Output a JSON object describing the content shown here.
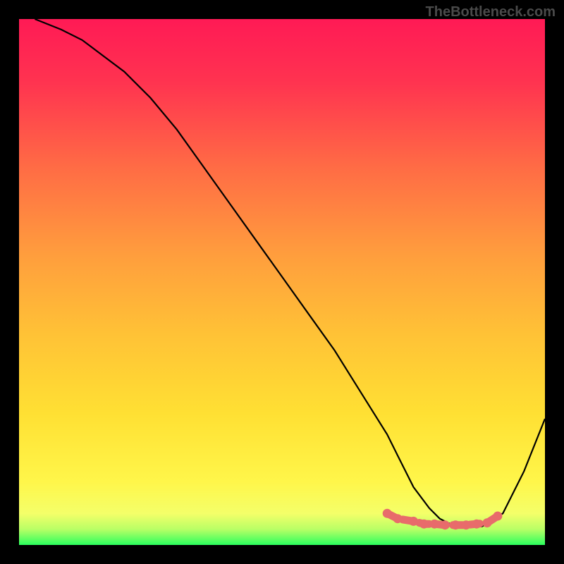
{
  "watermark": "TheBottleneck.com",
  "chart_data": {
    "type": "line",
    "title": "",
    "xlabel": "",
    "ylabel": "",
    "xlim": [
      0,
      100
    ],
    "ylim": [
      0,
      100
    ],
    "background_gradient": {
      "top_color": "#ff1a4d",
      "mid_color": "#ffd633",
      "bottom_green": "#2bff5e"
    },
    "series": [
      {
        "name": "main-curve",
        "color": "#000000",
        "x": [
          3,
          8,
          12,
          16,
          20,
          25,
          30,
          35,
          40,
          45,
          50,
          55,
          60,
          65,
          70,
          72,
          75,
          78,
          80,
          82,
          85,
          88,
          92,
          96,
          100
        ],
        "y": [
          100,
          98,
          96,
          93,
          90,
          85,
          79,
          72,
          65,
          58,
          51,
          44,
          37,
          29,
          21,
          17,
          11,
          7,
          5,
          4,
          3.5,
          3.5,
          6,
          14,
          24
        ]
      },
      {
        "name": "highlight-dots",
        "color": "#e86b6b",
        "x": [
          70,
          72,
          75,
          77,
          79,
          81,
          83,
          85,
          87,
          89,
          91
        ],
        "y": [
          6,
          5,
          4.5,
          4,
          4,
          3.8,
          3.8,
          3.8,
          4,
          4.2,
          5.5
        ]
      }
    ]
  }
}
